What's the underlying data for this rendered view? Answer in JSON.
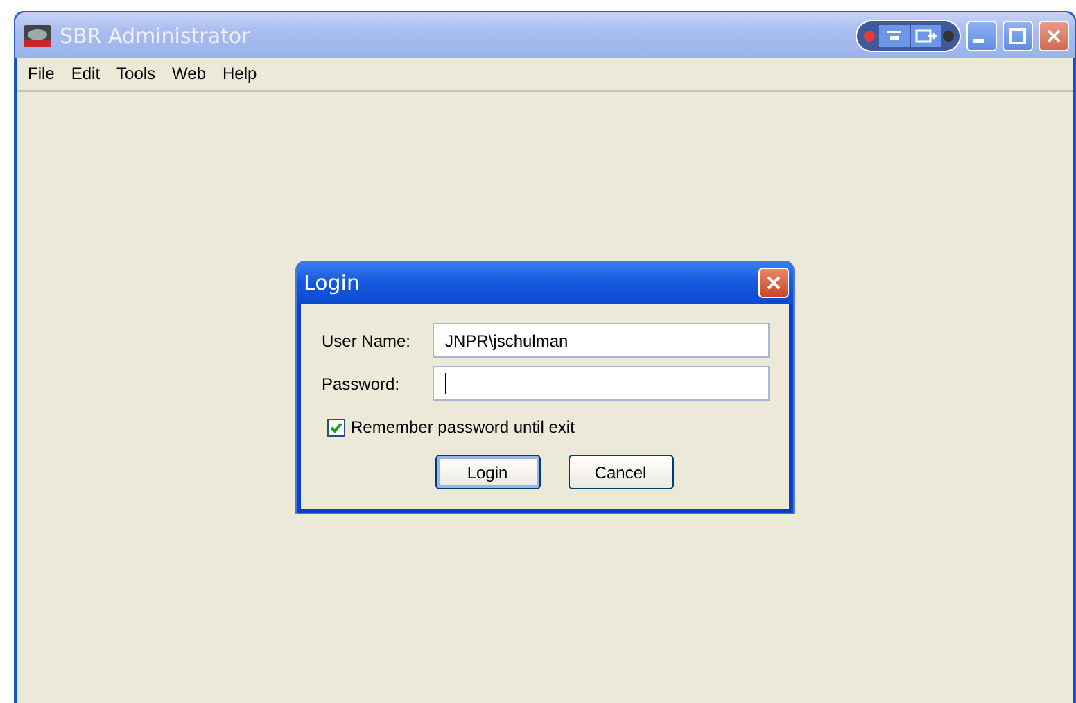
{
  "window": {
    "title": "SBR Administrator"
  },
  "menu": [
    {
      "label": "File"
    },
    {
      "label": "Edit"
    },
    {
      "label": "Tools"
    },
    {
      "label": "Web"
    },
    {
      "label": "Help"
    }
  ],
  "dialog": {
    "title": "Login",
    "fields": [
      {
        "label": "User Name:",
        "value": "JNPR\\jschulman",
        "focused": false
      },
      {
        "label": "Password:",
        "focused": true
      }
    ],
    "checkbox": {
      "label": "Remember password until exit",
      "checked": true
    },
    "buttons": [
      {
        "label": "Login",
        "default": true
      },
      {
        "label": "Cancel",
        "default": false
      }
    ]
  }
}
